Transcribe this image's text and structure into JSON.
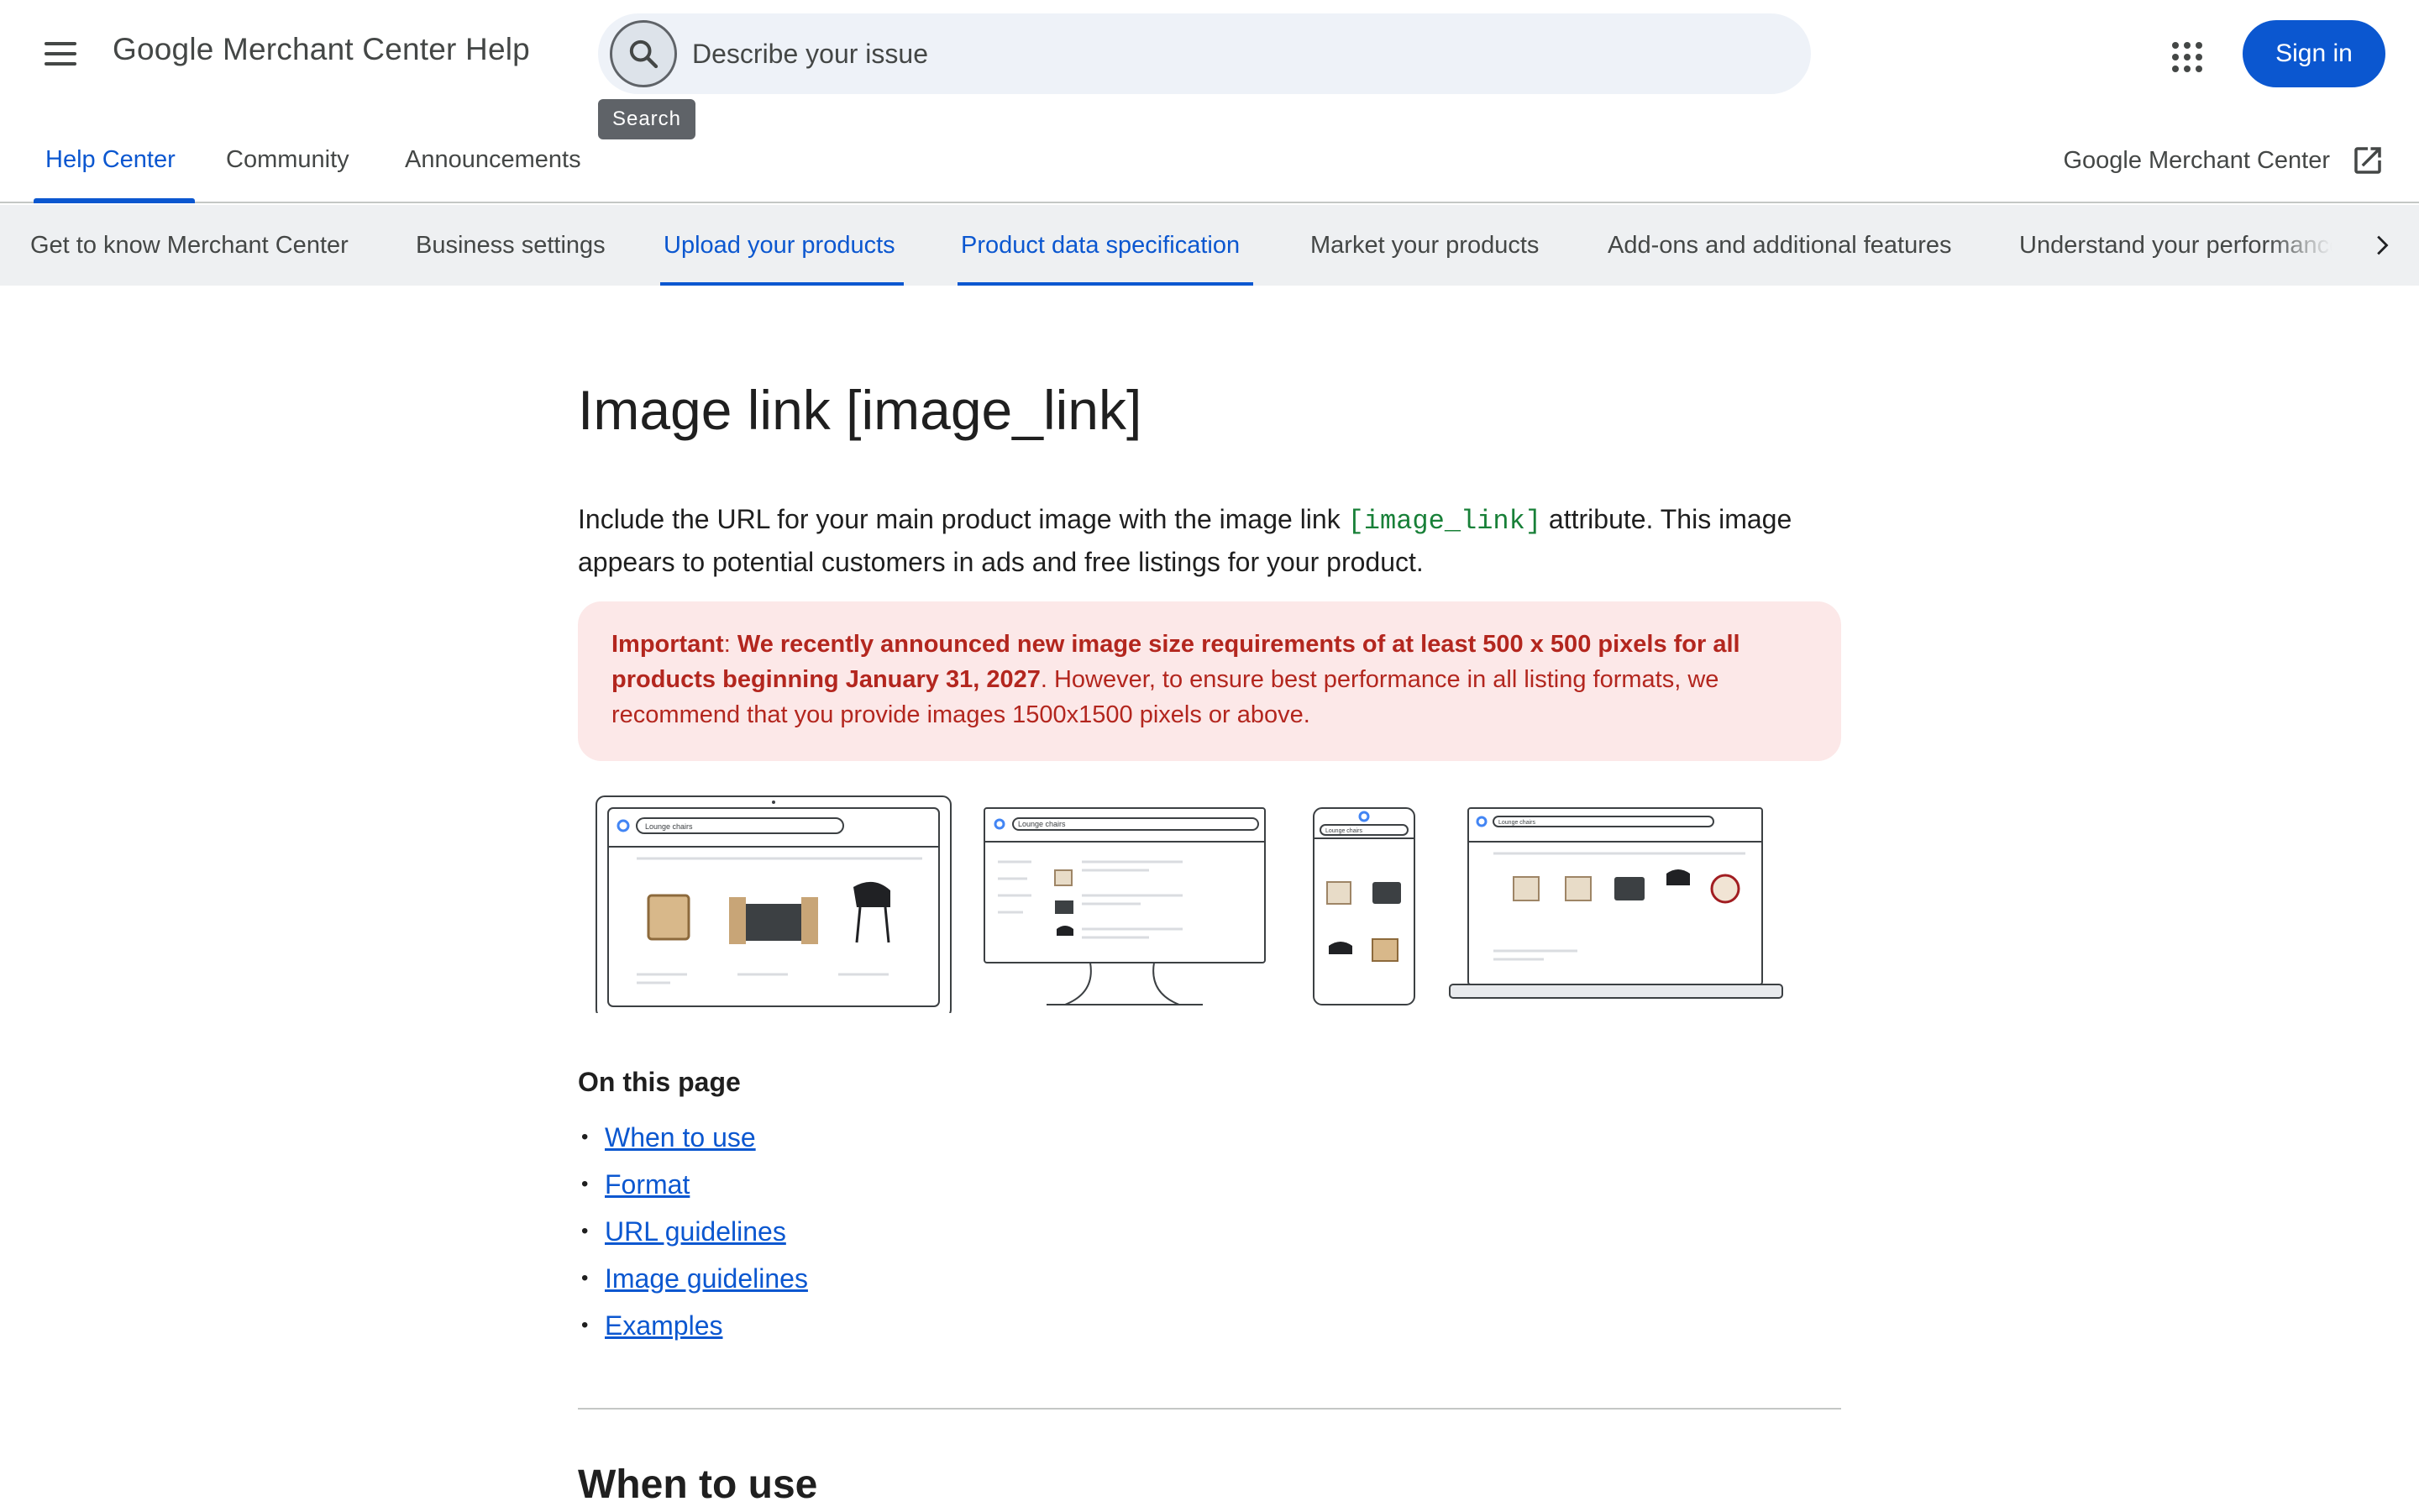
{
  "header": {
    "product_name": "Google Merchant Center Help",
    "search_placeholder": "Describe your issue",
    "search_tooltip": "Search",
    "sign_in_label": "Sign in"
  },
  "nav": {
    "tabs": [
      {
        "label": "Help Center",
        "active": true
      },
      {
        "label": "Community",
        "active": false
      },
      {
        "label": "Announcements",
        "active": false
      }
    ],
    "external_link_label": "Google Merchant Center"
  },
  "categories": [
    {
      "label": "Get to know Merchant Center",
      "active": false
    },
    {
      "label": "Business settings",
      "active": false
    },
    {
      "label": "Upload your products",
      "active": true
    },
    {
      "label": "Product data specification",
      "active": true
    },
    {
      "label": "Market your products",
      "active": false
    },
    {
      "label": "Add-ons and additional features",
      "active": false
    },
    {
      "label": "Understand your performance",
      "active": false
    }
  ],
  "article": {
    "title": "Image link [image_link]",
    "intro_before": "Include the URL for your main product image with the image link ",
    "intro_code": "[image_link]",
    "intro_after": " attribute. This image appears to potential customers in ads and free listings for your product.",
    "callout_label": "Important",
    "callout_sep": ": ",
    "callout_bold": "We recently announced new image size requirements of at least 500 x 500 pixels for all products beginning January 31, 2027",
    "callout_rest": ". However, to ensure best performance in all listing formats, we recommend that you provide images 1500x1500 pixels or above.",
    "illustration_search_text": "Lounge chairs",
    "on_this_page_title": "On this page",
    "toc": [
      "When to use",
      "Format",
      "URL guidelines",
      "Image guidelines",
      "Examples"
    ],
    "next_section_title": "When to use"
  },
  "colors": {
    "accent": "#0b57d0",
    "callout_bg": "#fce8e8",
    "callout_text": "#b3261e",
    "code_green": "#188038"
  }
}
